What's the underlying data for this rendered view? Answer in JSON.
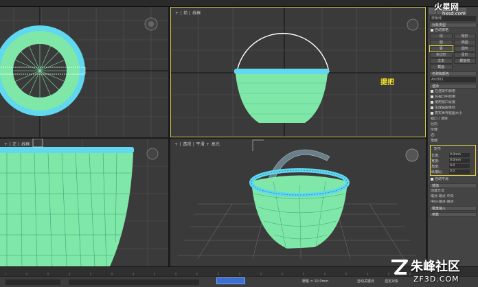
{
  "viewports": {
    "top_right": {
      "label": "+ | 前 | 线框",
      "annotation": "提把"
    },
    "bottom_left": {
      "label": "+ | 左 | 线框"
    },
    "bottom_right": {
      "label": "+ | 透视 | 平滑 + 高光"
    }
  },
  "command_panel": {
    "object_name": "样条线",
    "rollout_object_type": "对象类型",
    "autogrid": "自动栅格",
    "buttons": [
      "线",
      "矩形",
      "圆",
      "椭圆",
      "弧",
      "圆环",
      "多边形",
      "星形",
      "文本",
      "螺旋线",
      "截面"
    ],
    "selected_button": "弧",
    "rollout_name_color": "名称和颜色",
    "object_instance": "Arc001",
    "rollout_rendering": "渲染",
    "render_options": [
      "在渲染中启用",
      "在视口中启用",
      "使用视口设置",
      "生成贴图坐标",
      "真实世界贴图大小"
    ],
    "viewport_label": "视口",
    "render_label": "渲染",
    "radial_label": "径向",
    "thickness_label": "厚度:",
    "sides_label": "边:",
    "angle_label": "角度:",
    "rect_label": "矩形",
    "rect_params": [
      {
        "label": "长度:",
        "value": "0.0mm"
      },
      {
        "label": "宽度:",
        "value": "0.0mm"
      },
      {
        "label": "角度:",
        "value": "0.0"
      },
      {
        "label": "纵横比:",
        "value": "0.0"
      }
    ],
    "auto_smooth": "自动平滑",
    "rollout_interpolation": "插值",
    "create_method": "创建方法",
    "create_options": [
      "端点-端点-中央",
      "中间-端点-端点"
    ],
    "rollout_keyboard": "键盘输入",
    "rollout_params": "参数"
  },
  "statusbar": {
    "grid": "栅格 = 10.0mm",
    "autokey": "自动关键点",
    "selected": "选定对象"
  },
  "watermarks": {
    "top_brand": "火星网",
    "top_url": "hxsd.com",
    "bottom_brand": "朱峰社区",
    "bottom_url": "ZF3D.COM"
  },
  "colors": {
    "wire_cyan": "#5fd8f0",
    "wire_green": "#7fe8a8",
    "highlight_yellow": "#e8d84a",
    "viewport_bg": "#3a3a3a"
  }
}
